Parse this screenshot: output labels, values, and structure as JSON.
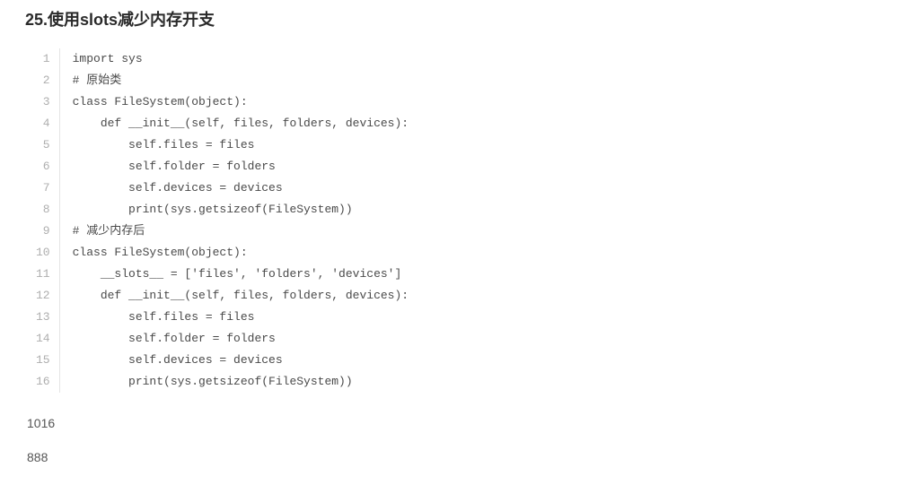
{
  "heading": "25.使用slots减少内存开支",
  "code": {
    "lines": [
      "import sys",
      "# 原始类",
      "class FileSystem(object):",
      "    def __init__(self, files, folders, devices):",
      "        self.files = files",
      "        self.folder = folders",
      "        self.devices = devices",
      "        print(sys.getsizeof(FileSystem))",
      "# 减少内存后",
      "class FileSystem(object):",
      "    __slots__ = ['files', 'folders', 'devices']",
      "    def __init__(self, files, folders, devices):",
      "        self.files = files",
      "        self.folder = folders",
      "        self.devices = devices",
      "        print(sys.getsizeof(FileSystem))"
    ]
  },
  "outputs": [
    "1016",
    "888"
  ]
}
